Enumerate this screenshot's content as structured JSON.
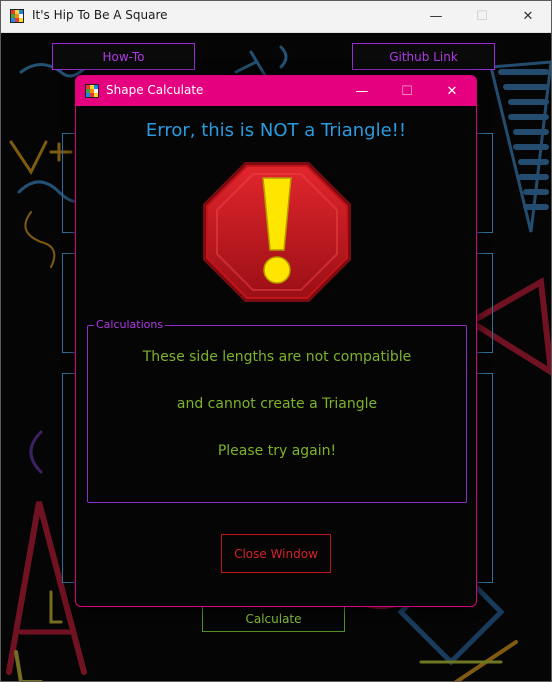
{
  "main_window": {
    "title": "It's Hip To Be A Square",
    "controls": {
      "minimize": "—",
      "maximize": "☐",
      "close": "✕"
    },
    "howto_button": "How-To",
    "github_button": "Github Link",
    "calculate_button": "Calculate"
  },
  "dialog": {
    "title": "Shape Calculate",
    "controls": {
      "minimize": "—",
      "maximize": "☐",
      "close": "✕"
    },
    "error_heading": "Error, this is NOT a Triangle!!",
    "calculations_legend": "Calculations",
    "messages": [
      "These side lengths are not compatible",
      "and cannot create a Triangle",
      "Please try again!"
    ],
    "close_button": "Close Window"
  },
  "colors": {
    "dialog_titlebar": "#e5007f",
    "error_heading": "#2a9be0",
    "message_text": "#7db32a",
    "calculations_border": "#8a2fc8",
    "close_button": "#d8202a",
    "stop_sign": "#c4141b",
    "exclamation": "#ffe600"
  },
  "icons": {
    "app": "rubiks-cube-icon",
    "warning": "stop-sign-exclamation-icon"
  }
}
